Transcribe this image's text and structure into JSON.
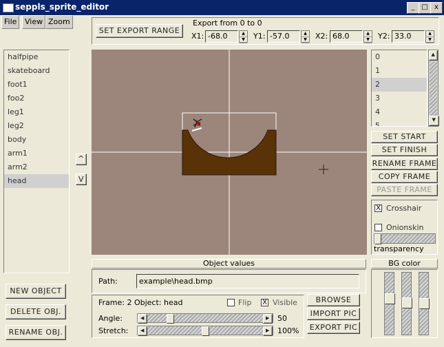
{
  "window": {
    "title": "seppls_sprite_editor",
    "min": "_",
    "max": "□",
    "close": "x"
  },
  "menu": {
    "file": "File",
    "view": "View",
    "zoom": "Zoom"
  },
  "export": {
    "range_button": "SET EXPORT RANGE",
    "range_text": "Export from 0 to 0",
    "x1_label": "X1:",
    "x1": "-68.0",
    "y1_label": "Y1:",
    "y1": "-57.0",
    "x2_label": "X2:",
    "x2": "68.0",
    "y2_label": "Y2:",
    "y2": "33.0"
  },
  "objects": [
    "halfpipe",
    "skateboard",
    "foot1",
    "foo2",
    "leg1",
    "leg2",
    "body",
    "arm1",
    "arm2",
    "head"
  ],
  "selected_object": "head",
  "order_up": "^",
  "order_down": "V",
  "frames": [
    "0",
    "1",
    "2",
    "3",
    "4",
    "5"
  ],
  "selected_frame": "2",
  "frame_buttons": {
    "set_start": "SET START",
    "set_finish": "SET FINISH",
    "rename": "RENAME FRAME",
    "copy": "COPY FRAME",
    "paste": "PASTE FRAME"
  },
  "view_opts": {
    "crosshair_label": "Crosshair",
    "crosshair_checked": "X",
    "onionskin_label": "Onionskin",
    "onionskin_checked": "",
    "transparency_label": "transparency"
  },
  "obj_buttons": {
    "new": "NEW OBJECT",
    "delete": "DELETE OBJ.",
    "rename": "RENAME OBJ."
  },
  "object_values": {
    "header": "Object values",
    "path_label": "Path:",
    "path": "example\\head.bmp",
    "frame_info": "Frame: 2  Object: head",
    "flip_label": "Flip",
    "flip_checked": "",
    "visible_label": "Visible",
    "visible_checked": "X",
    "angle_label": "Angle:",
    "angle_value": "50",
    "stretch_label": "Stretch:",
    "stretch_value": "100%",
    "browse": "BROWSE",
    "import": "IMPORT PIC",
    "export": "EXPORT PIC"
  },
  "bg_color": {
    "header": "BG color"
  },
  "colors": {
    "canvas": "#9c857a",
    "halfpipe": "#5a3208",
    "title_bar": "#0a246a",
    "crosshair": "#ffffff"
  }
}
